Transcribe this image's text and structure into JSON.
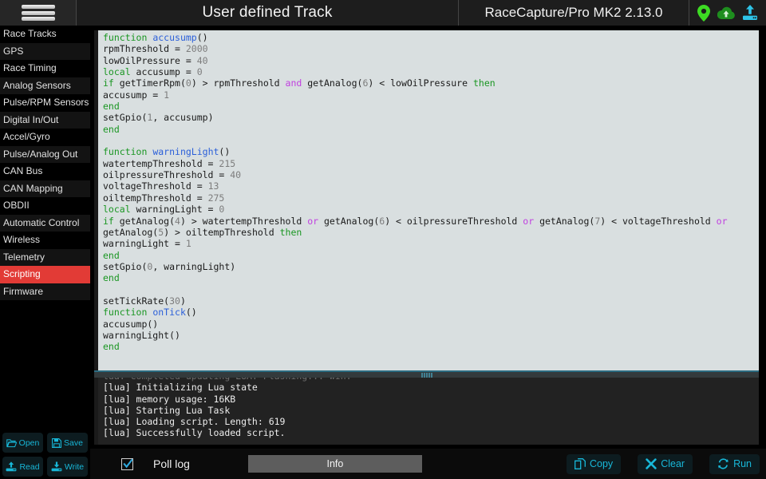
{
  "header": {
    "menu_icon": "hamburger-icon",
    "title": "User defined Track",
    "device": "RaceCapture/Pro MK2 2.13.0",
    "status_icons": [
      {
        "name": "gps-pin-icon",
        "color": "#3ddb23"
      },
      {
        "name": "cloud-upload-icon",
        "color": "#1e8e1e"
      },
      {
        "name": "device-upload-icon",
        "color": "#2ec4e8"
      }
    ]
  },
  "sidebar": {
    "items": [
      {
        "label": "Race Tracks",
        "active": false
      },
      {
        "label": "GPS",
        "active": false
      },
      {
        "label": "Race Timing",
        "active": false
      },
      {
        "label": "Analog Sensors",
        "active": false
      },
      {
        "label": "Pulse/RPM Sensors",
        "active": false
      },
      {
        "label": "Digital In/Out",
        "active": false
      },
      {
        "label": "Accel/Gyro",
        "active": false
      },
      {
        "label": "Pulse/Analog Out",
        "active": false
      },
      {
        "label": "CAN Bus",
        "active": false
      },
      {
        "label": "CAN Mapping",
        "active": false
      },
      {
        "label": "OBDII",
        "active": false
      },
      {
        "label": "Automatic Control",
        "active": false
      },
      {
        "label": "Wireless",
        "active": false
      },
      {
        "label": "Telemetry",
        "active": false
      },
      {
        "label": "Scripting",
        "active": true
      },
      {
        "label": "Firmware",
        "active": false
      }
    ],
    "active_color": "#e23b36",
    "buttons": [
      {
        "label": "Open",
        "icon": "folder-open-icon"
      },
      {
        "label": "Save",
        "icon": "floppy-disk-icon"
      },
      {
        "label": "Read",
        "icon": "download-from-device-icon"
      },
      {
        "label": "Write",
        "icon": "upload-to-device-icon"
      }
    ]
  },
  "editor": {
    "language": "lua",
    "accent_colors": {
      "keyword": "#1a9622",
      "function": "#2b5fd9",
      "number": "#7d7d7d",
      "operator": "#c03fe0",
      "background": "#d9dfe0"
    },
    "lines": [
      [
        [
          "kw",
          "function"
        ],
        [
          "pl",
          " "
        ],
        [
          "fn",
          "accusump"
        ],
        [
          "pl",
          "()"
        ]
      ],
      [
        [
          "pl",
          "rpmThreshold = "
        ],
        [
          "num",
          "2000"
        ]
      ],
      [
        [
          "pl",
          "lowOilPressure = "
        ],
        [
          "num",
          "40"
        ]
      ],
      [
        [
          "kw",
          "local"
        ],
        [
          "pl",
          " accusump = "
        ],
        [
          "num",
          "0"
        ]
      ],
      [
        [
          "kw",
          "if"
        ],
        [
          "pl",
          " getTimerRpm("
        ],
        [
          "num",
          "0"
        ],
        [
          "pl",
          ") > rpmThreshold "
        ],
        [
          "op",
          "and"
        ],
        [
          "pl",
          " getAnalog("
        ],
        [
          "num",
          "6"
        ],
        [
          "pl",
          ") < lowOilPressure "
        ],
        [
          "kw",
          "then"
        ]
      ],
      [
        [
          "pl",
          "accusump = "
        ],
        [
          "num",
          "1"
        ]
      ],
      [
        [
          "kw",
          "end"
        ]
      ],
      [
        [
          "pl",
          "setGpio("
        ],
        [
          "num",
          "1"
        ],
        [
          "pl",
          ", accusump)"
        ]
      ],
      [
        [
          "kw",
          "end"
        ]
      ],
      [
        [
          "pl",
          ""
        ]
      ],
      [
        [
          "kw",
          "function"
        ],
        [
          "pl",
          " "
        ],
        [
          "fn",
          "warningLight"
        ],
        [
          "pl",
          "()"
        ]
      ],
      [
        [
          "pl",
          "watertempThreshold = "
        ],
        [
          "num",
          "215"
        ]
      ],
      [
        [
          "pl",
          "oilpressureThreshold = "
        ],
        [
          "num",
          "40"
        ]
      ],
      [
        [
          "pl",
          "voltageThreshold = "
        ],
        [
          "num",
          "13"
        ]
      ],
      [
        [
          "pl",
          "oiltempThreshold = "
        ],
        [
          "num",
          "275"
        ]
      ],
      [
        [
          "kw",
          "local"
        ],
        [
          "pl",
          " warningLight = "
        ],
        [
          "num",
          "0"
        ]
      ],
      [
        [
          "kw",
          "if"
        ],
        [
          "pl",
          " getAnalog("
        ],
        [
          "num",
          "4"
        ],
        [
          "pl",
          ") > watertempThreshold "
        ],
        [
          "op",
          "or"
        ],
        [
          "pl",
          " getAnalog("
        ],
        [
          "num",
          "6"
        ],
        [
          "pl",
          ") < oilpressureThreshold "
        ],
        [
          "op",
          "or"
        ],
        [
          "pl",
          " getAnalog("
        ],
        [
          "num",
          "7"
        ],
        [
          "pl",
          ") < voltageThreshold "
        ],
        [
          "op",
          "or"
        ]
      ],
      [
        [
          "pl",
          "getAnalog("
        ],
        [
          "num",
          "5"
        ],
        [
          "pl",
          ") > oiltempThreshold "
        ],
        [
          "kw",
          "then"
        ]
      ],
      [
        [
          "pl",
          "warningLight = "
        ],
        [
          "num",
          "1"
        ]
      ],
      [
        [
          "kw",
          "end"
        ]
      ],
      [
        [
          "pl",
          "setGpio("
        ],
        [
          "num",
          "0"
        ],
        [
          "pl",
          ", warningLight)"
        ]
      ],
      [
        [
          "kw",
          "end"
        ]
      ],
      [
        [
          "pl",
          ""
        ]
      ],
      [
        [
          "pl",
          "setTickRate("
        ],
        [
          "num",
          "30"
        ],
        [
          "pl",
          ")"
        ]
      ],
      [
        [
          "kw",
          "function"
        ],
        [
          "pl",
          " "
        ],
        [
          "fn",
          "onTick"
        ],
        [
          "pl",
          "()"
        ]
      ],
      [
        [
          "pl",
          "accusump()"
        ]
      ],
      [
        [
          "pl",
          "warningLight()"
        ]
      ],
      [
        [
          "kw",
          "end"
        ]
      ]
    ]
  },
  "log": {
    "clipped_line": "lua: Completed updating LUA. Flashing... win:",
    "lines": [
      "[lua] Initializing Lua state",
      "[lua] memory usage: 16KB",
      "[lua] Starting Lua Task",
      "[lua] Loading script. Length: 619",
      "[lua] Successfully loaded script."
    ]
  },
  "bottombar": {
    "poll_log_label": "Poll log",
    "poll_log_checked": true,
    "level_select": "Info",
    "buttons": [
      {
        "label": "Copy",
        "icon": "copy-icon"
      },
      {
        "label": "Clear",
        "icon": "x-icon"
      },
      {
        "label": "Run",
        "icon": "refresh-icon"
      }
    ]
  }
}
